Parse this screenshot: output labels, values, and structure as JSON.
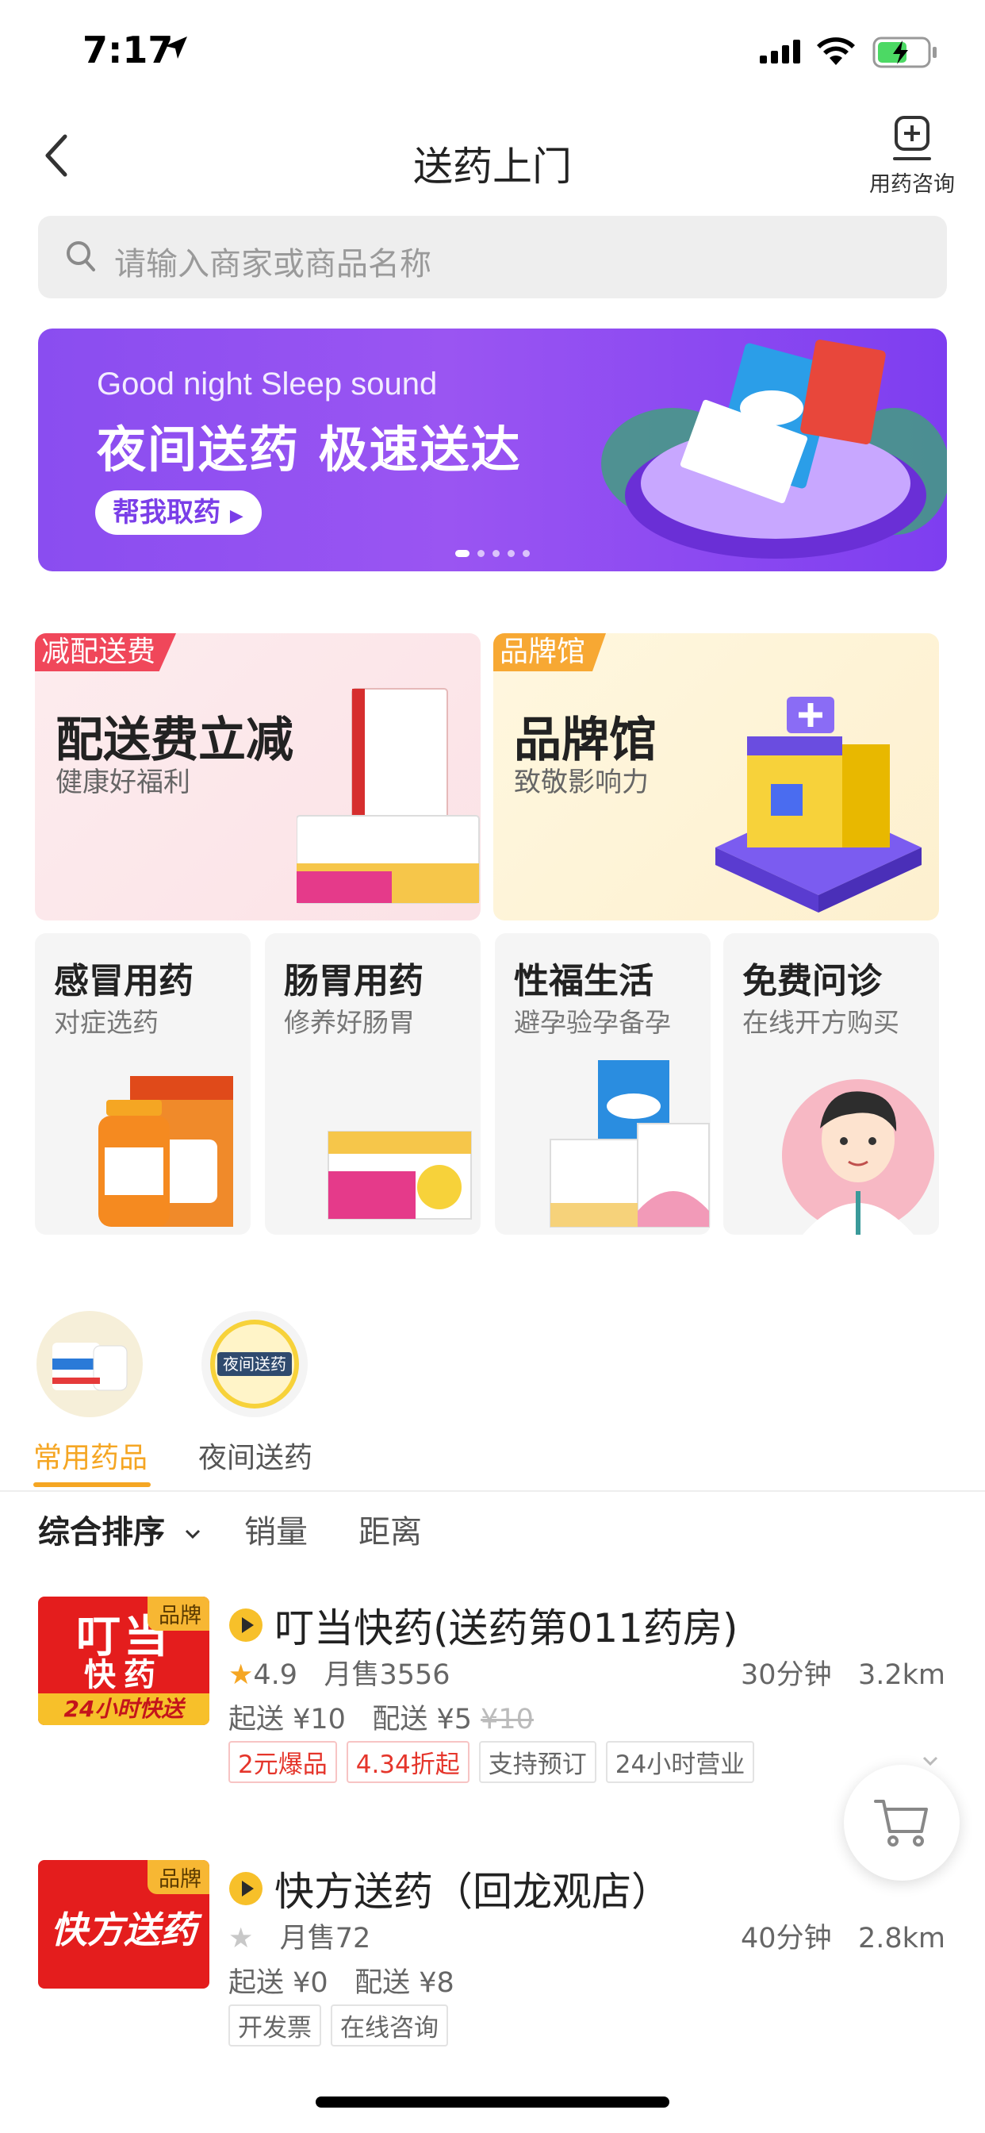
{
  "status_bar": {
    "time": "7:17"
  },
  "nav": {
    "title": "送药上门",
    "consult_label": "用药咨询"
  },
  "search": {
    "placeholder": "请输入商家或商品名称"
  },
  "banner": {
    "subtitle_en": "Good night Sleep sound",
    "title_cn": "夜间送药 极速送达",
    "button_label": "帮我取药",
    "dots": 5
  },
  "features": {
    "big": [
      {
        "tag": "减配送费",
        "title": "配送费立减",
        "subtitle": "健康好福利"
      },
      {
        "tag": "品牌馆",
        "title": "品牌馆",
        "subtitle": "致敬影响力"
      }
    ],
    "small": [
      {
        "title": "感冒用药",
        "subtitle": "对症选药"
      },
      {
        "title": "肠胃用药",
        "subtitle": "修养好肠胃"
      },
      {
        "title": "性福生活",
        "subtitle": "避孕验孕备孕"
      },
      {
        "title": "免费问诊",
        "subtitle": "在线开方购买"
      }
    ]
  },
  "tabs": [
    {
      "label": "常用药品",
      "active": true
    },
    {
      "label": "夜间送药",
      "active": false,
      "icon_text": "夜间送药"
    }
  ],
  "sort": {
    "options": [
      "综合排序",
      "销量",
      "距离"
    ]
  },
  "stores": [
    {
      "badge": "品牌",
      "logo_lines": [
        "叮当",
        "快药",
        "24小时快送"
      ],
      "name": "叮当快药(送药第011药房)",
      "rating": "4.9",
      "monthly_sales": "月售3556",
      "time": "30分钟",
      "distance": "3.2km",
      "min_order": "起送 ¥10",
      "delivery": "配送 ¥5",
      "delivery_original": "¥10",
      "tags": [
        "2元爆品",
        "4.34折起",
        "支持预订",
        "24小时营业"
      ]
    },
    {
      "badge": "品牌",
      "logo_lines": [
        "快方送药"
      ],
      "name": "快方送药（回龙观店）",
      "rating": "",
      "monthly_sales": "月售72",
      "time": "40分钟",
      "distance": "2.8km",
      "min_order": "起送 ¥0",
      "delivery": "配送 ¥8",
      "tags": [
        "开发票",
        "在线咨询"
      ]
    }
  ],
  "colors": {
    "accent": "#f5a623",
    "banner_purple": "#8a4df0",
    "hot_red": "#e5352b"
  }
}
